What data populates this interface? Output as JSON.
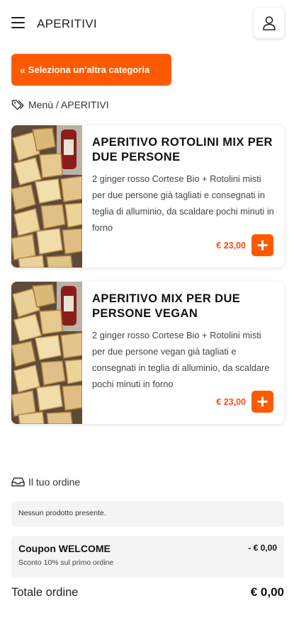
{
  "header": {
    "title": "APERITIVI",
    "menu_icon": "hamburger-menu-icon",
    "account_icon": "user-icon"
  },
  "category_button": {
    "label": "Seleziona un'altra categoria",
    "icon": "double-chevron-left-icon",
    "color": "#ff5a00"
  },
  "breadcrumb": {
    "icon": "tags-icon",
    "text": "Menù / APERITIVI"
  },
  "products": [
    {
      "title": "APERITIVO ROTOLINI MIX PER DUE PERSONE",
      "description": "2 ginger rosso Cortese Bio + Rotolini misti per due persone già tagliati e consegnati in teglia di alluminio, da scaldare pochi minuti in forno",
      "price": "€ 23,00",
      "add_icon": "plus-icon"
    },
    {
      "title": "APERITIVO MIX PER DUE PERSONE VEGAN",
      "description": "2 ginger rosso Cortese Bio + Rotolini misti per due persone vegan già tagliati e consegnati in teglia di alluminio, da scaldare pochi minuti in forno",
      "price": "€ 23,00",
      "add_icon": "plus-icon"
    }
  ],
  "order": {
    "icon": "inbox-icon",
    "title": "Il tuo ordine",
    "empty_text": "Nessun prodotto presente.",
    "coupon": {
      "title": "Coupon WELCOME",
      "description": "Sconto 10% sul primo ordine",
      "amount": "- € 0,00"
    },
    "total_label": "Totale ordine",
    "total_value": "€ 0,00"
  },
  "colors": {
    "accent": "#ff5a00",
    "price": "#ff4a1a",
    "panel_bg": "#f4f4f4"
  }
}
